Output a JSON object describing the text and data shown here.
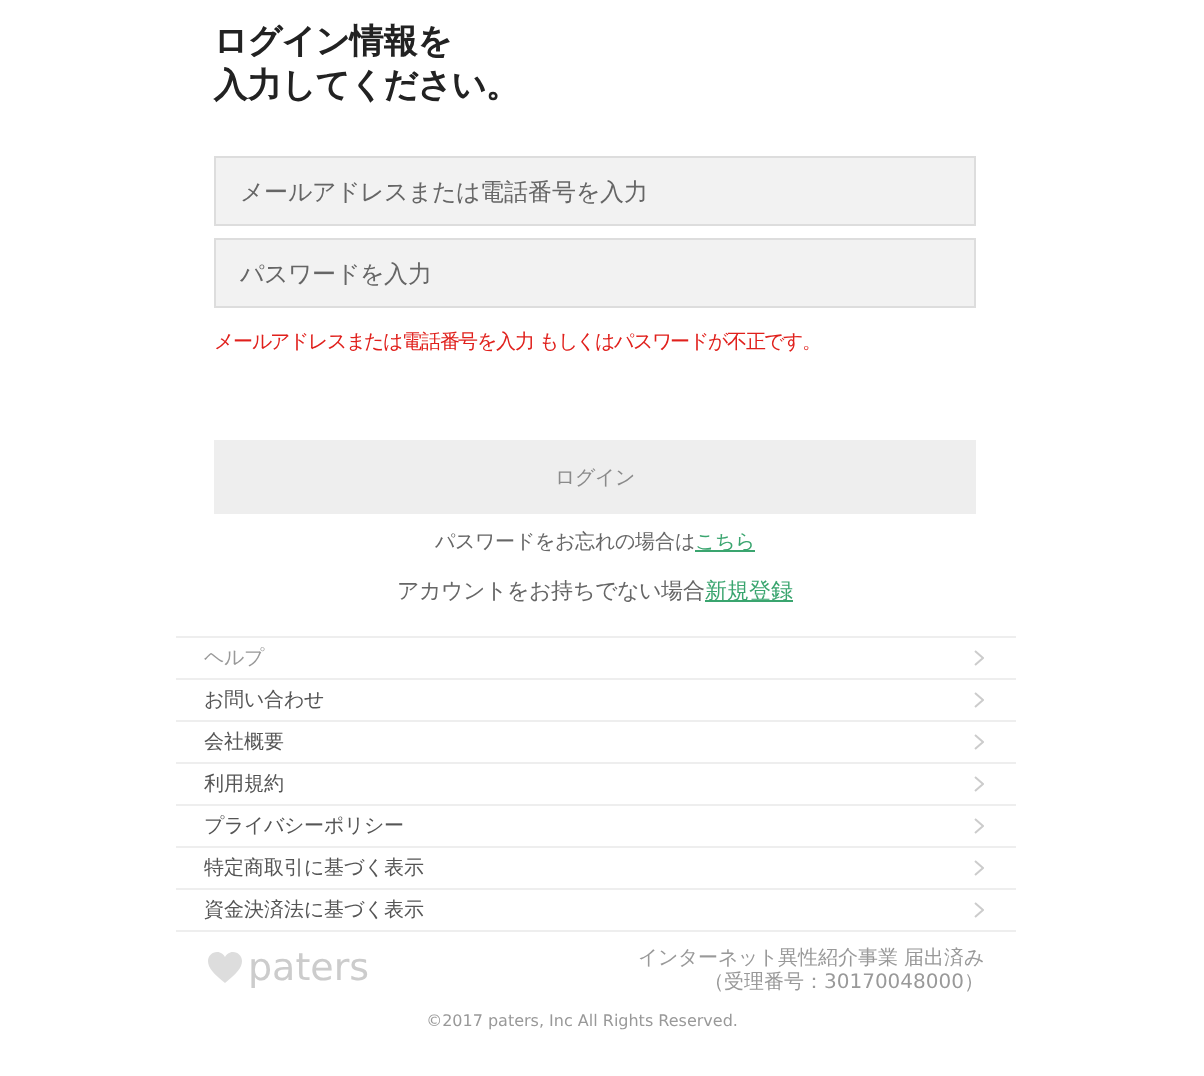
{
  "heading": {
    "lines": [
      "ログイン情報を",
      "入力してください。"
    ]
  },
  "fields": [
    {
      "placeholder": "メールアドレスまたは電話番号を入力"
    },
    {
      "placeholder": "パスワードを入力"
    }
  ],
  "error": "メールアドレスまたは電話番号を入力 もしくはパスワードが不正です。",
  "login_button": {
    "label": "ログイン",
    "disabled": true
  },
  "forgot": {
    "text": "パスワードをお忘れの場合は",
    "link": "こちら"
  },
  "signup": {
    "text": "アカウントをお持ちでない場合",
    "link": "新規登録"
  },
  "menu": [
    {
      "label": "ヘルプ"
    },
    {
      "label": "お問い合わせ"
    },
    {
      "label": "会社概要"
    },
    {
      "label": "利用規約"
    },
    {
      "label": "プライバシーポリシー"
    },
    {
      "label": "特定商取引に基づく表示"
    },
    {
      "label": "資金決済法に基づく表示"
    }
  ],
  "footer": {
    "logo": "paters",
    "notice": [
      "インターネット異性紹介事業 届出済み",
      "（受理番号：30170048000）"
    ],
    "copyright": "©2017 paters, Inc All Rights Reserved."
  }
}
